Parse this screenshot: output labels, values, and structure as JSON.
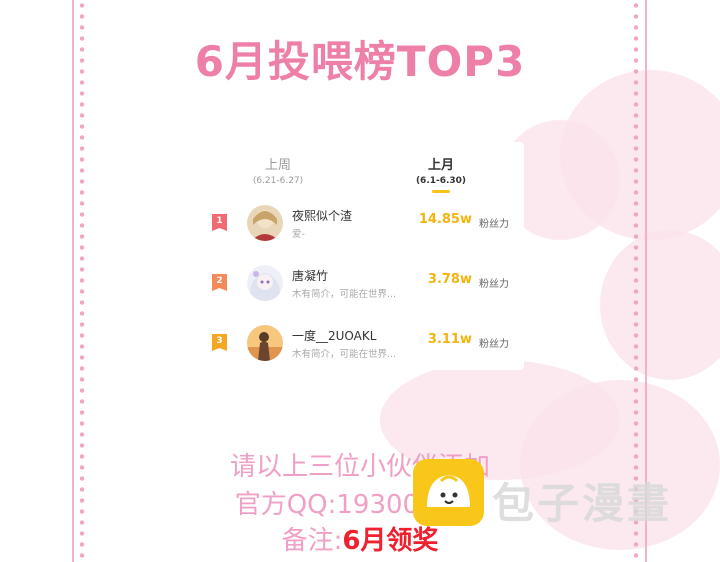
{
  "headline": "6月投喂榜TOP3",
  "tabs": [
    {
      "label": "上周",
      "range": "(6.21-6.27)"
    },
    {
      "label": "上月",
      "range": "(6.1-6.30)"
    }
  ],
  "ranking": [
    {
      "rank": "1",
      "name": "夜熙似个渣",
      "bio": "爱-",
      "value": "14.85w",
      "unit": "粉丝力"
    },
    {
      "rank": "2",
      "name": "唐凝竹",
      "bio": "木有简介，可能在世界...",
      "value": "3.78w",
      "unit": "粉丝力"
    },
    {
      "rank": "3",
      "name": "一度__2UOAKL",
      "bio": "木有简介，可能在世界...",
      "value": "3.11w",
      "unit": "粉丝力"
    }
  ],
  "info": {
    "line1": "请以上三位小伙伴添加",
    "line2": "官方QQ:193002128",
    "line3_prefix": "备注:",
    "line3_highlight": "6月领奖"
  },
  "watermark": "包子漫畫",
  "colors": {
    "accent": "#ee7fa8",
    "value": "#f2b40e",
    "rank1": "#f06a72",
    "rank2": "#f38a5a",
    "rank3": "#f5a623",
    "highlight": "#f0202e"
  }
}
